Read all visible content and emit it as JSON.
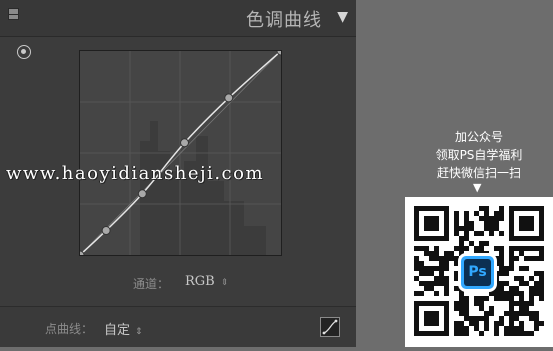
{
  "panel": {
    "title": "色调曲线",
    "collapse_icon": "panel-square-icon",
    "triangle_icon": "collapse-triangle-icon",
    "target_icon": "target-adjust-icon"
  },
  "curve": {
    "points": [
      [
        0,
        0
      ],
      [
        0.13,
        0.12
      ],
      [
        0.31,
        0.3
      ],
      [
        0.52,
        0.55
      ],
      [
        0.74,
        0.77
      ],
      [
        1,
        1
      ]
    ]
  },
  "channel": {
    "label": "通道：",
    "value": "RGB",
    "arrow": "⇕"
  },
  "footer": {
    "point_curve_label": "点曲线：",
    "point_curve_value": "自定",
    "arrow": "⇕",
    "edit_icon": "edit-point-curve-icon"
  },
  "watermark": "www.haoyidiansheji.com",
  "promo": {
    "line1": "加公众号",
    "line2": "领取PS自学福利",
    "line3": "赶快微信扫一扫",
    "arrow": "▼",
    "badge": "Ps"
  },
  "colors": {
    "panel_bg": "#3c3c3c",
    "curve_line": "#e6e6e6",
    "page_bg": "#6d6d6d",
    "ps_blue": "#31a8ff"
  }
}
